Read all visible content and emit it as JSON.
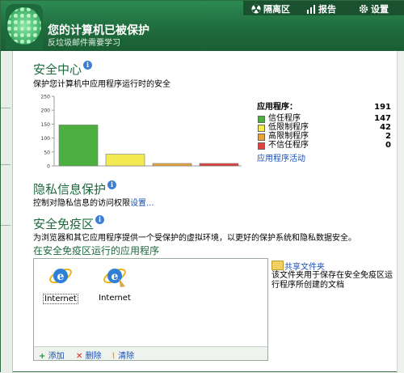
{
  "topbar": {
    "quarantine": "隔离区",
    "report": "报告",
    "settings": "设置"
  },
  "header": {
    "title": "您的计算机已被保护",
    "subtitle": "反垃圾邮件需要学习"
  },
  "security_center": {
    "title": "安全中心",
    "desc": "保护您计算机中应用程序运行时的安全",
    "legend_title": "应用程序：",
    "legend_total": "191",
    "legend": [
      {
        "label": "信任程序",
        "value": "147",
        "color": "#4caf3f"
      },
      {
        "label": "低限制程序",
        "value": "42",
        "color": "#f2ea50"
      },
      {
        "label": "高限制程序",
        "value": "2",
        "color": "#e8a33a"
      },
      {
        "label": "不信任程序",
        "value": "0",
        "color": "#e04040"
      }
    ],
    "activity_link": "应用程序活动"
  },
  "chart_data": {
    "type": "bar",
    "categories": [
      "信任程序",
      "低限制程序",
      "高限制程序",
      "不信任程序"
    ],
    "values": [
      147,
      42,
      2,
      0
    ],
    "colors": [
      "#4caf3f",
      "#f2ea50",
      "#e8a33a",
      "#e04040"
    ],
    "ylim": [
      0,
      250
    ],
    "yticks": [
      "0",
      "50",
      "100",
      "150",
      "200",
      "250"
    ]
  },
  "privacy": {
    "title": "隐私信息保护",
    "desc": "控制对隐私信息的访问权限",
    "settings_link": "设置..."
  },
  "sandbox": {
    "title": "安全免疫区",
    "desc": "为浏览器和其它应用程序提供一个受保护的虚拟环境，以更好的保护系统和隐私数据安全。",
    "apps_title": "在安全免疫区运行的应用程序",
    "apps": [
      {
        "label": "Internet",
        "icon": "ie-icon"
      },
      {
        "label": "Internet",
        "icon": "ie-broom-icon"
      }
    ],
    "add": "添加",
    "delete": "删除",
    "clear": "清除",
    "shared_folder": "共享文件夹",
    "shared_desc": "该文件夹用于保存在安全免疫区运行程序所创建的文档"
  }
}
